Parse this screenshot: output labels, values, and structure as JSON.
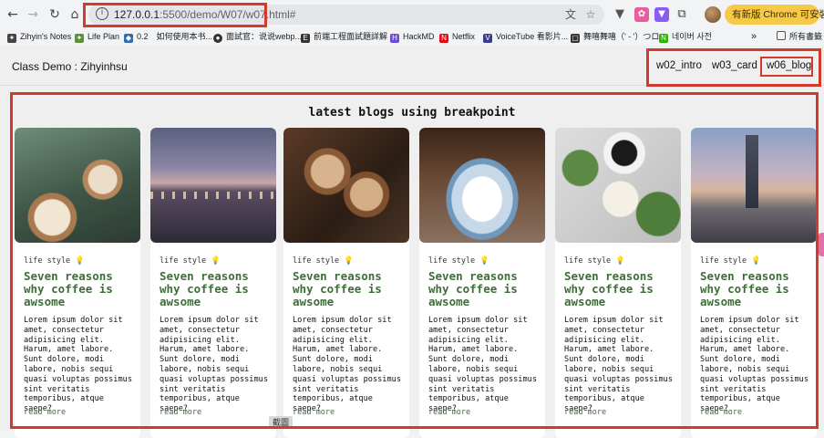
{
  "browser": {
    "url_host": "127.0.0.1",
    "url_path": ":5500/demo/W07/w07.html#",
    "update_button": "有新版 Chrome 可安裝",
    "update_more": "⋮"
  },
  "bookmarks": [
    {
      "label": "Zihyin's Notes",
      "color": "#444"
    },
    {
      "label": "Life Plan",
      "color": "#5b8f3a"
    },
    {
      "label": "0.2　如何使用本书...",
      "color": "#2f6db3"
    },
    {
      "label": "面試官：说说webp...",
      "color": "#333"
    },
    {
      "label": "前端工程面試題詳解",
      "color": "#333"
    },
    {
      "label": "HackMD",
      "color": "#6b4bd6"
    },
    {
      "label": "Netflix",
      "color": "#e50914"
    },
    {
      "label": "VoiceTube 看影片...",
      "color": "#3b3b8f"
    },
    {
      "label": "舞嘻舞嘻（' - '）つロ...",
      "color": "#333"
    },
    {
      "label": "네이버 사전",
      "color": "#2db400"
    }
  ],
  "bookmarks_more": "»",
  "bookmarks_folder": "所有書籤",
  "header": {
    "brand": "Class Demo : Zihyinhsu",
    "nav": [
      "w02_intro",
      "w03_card",
      "w06_blog"
    ]
  },
  "section_title": "latest blogs using breakpoint",
  "cards": [
    {
      "image": "latte-cups-photo",
      "tag": "life style 💡",
      "title": "Seven reasons why coffee is awsome",
      "body": "Lorem ipsum dolor sit amet, consectetur adipisicing elit. Harum, amet labore. Sunt dolore, modi labore, nobis sequi quasi voluptas possimus sint veritatis temporibus, atque saepe?",
      "more": "read more"
    },
    {
      "image": "bridge-lamps-photo",
      "tag": "life style 💡",
      "title": "Seven reasons why coffee is awsome",
      "body": "Lorem ipsum dolor sit amet, consectetur adipisicing elit. Harum, amet labore. Sunt dolore, modi labore, nobis sequi quasi voluptas possimus sint veritatis temporibus, atque saepe?",
      "more": "read more"
    },
    {
      "image": "cheers-coffee-photo",
      "tag": "life style 💡",
      "title": "Seven reasons why coffee is awsome",
      "body": "Lorem ipsum dolor sit amet, consectetur adipisicing elit. Harum, amet labore. Sunt dolore, modi labore, nobis sequi quasi voluptas possimus sint veritatis temporibus, atque saepe?",
      "more": "read more"
    },
    {
      "image": "blue-cup-photo",
      "tag": "life style 💡",
      "title": "Seven reasons why coffee is awsome",
      "body": "Lorem ipsum dolor sit amet, consectetur adipisicing elit. Harum, amet labore. Sunt dolore, modi labore, nobis sequi quasi voluptas possimus sint veritatis temporibus, atque saepe?",
      "more": "read more"
    },
    {
      "image": "coffee-notes-photo",
      "tag": "life style 💡",
      "title": "Seven reasons why coffee is awsome",
      "body": "Lorem ipsum dolor sit amet, consectetur adipisicing elit. Harum, amet labore. Sunt dolore, modi labore, nobis sequi quasi voluptas possimus sint veritatis temporibus, atque saepe?",
      "more": "read more"
    },
    {
      "image": "taipei-101-photo",
      "tag": "life style 💡",
      "title": "Seven reasons why coffee is awsome",
      "body": "Lorem ipsum dolor sit amet, consectetur adipisicing elit. Harum, amet labore. Sunt dolore, modi labore, nobis sequi quasi voluptas possimus sint veritatis temporibus, atque saepe?",
      "more": "read more"
    }
  ],
  "screenshot_label": "截圖",
  "annotation_color": "#d13b2b"
}
